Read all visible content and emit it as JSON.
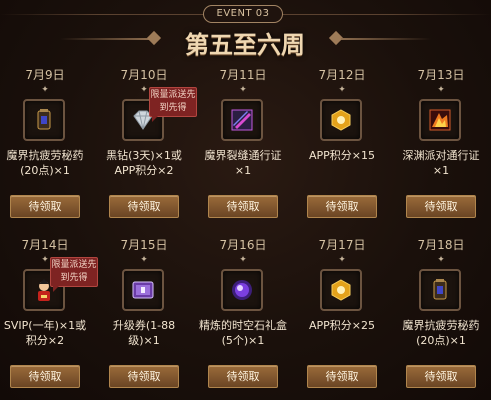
{
  "header": {
    "event_label": "EVENT 03",
    "title": "第五至六周"
  },
  "rewards": [
    {
      "date": "7月9日",
      "desc": "魔界抗疲劳秘药(20点)×1",
      "tag": "",
      "icon": "potion-icon",
      "button": "待领取"
    },
    {
      "date": "7月10日",
      "desc": "黑钻(3天)×1或APP积分×2",
      "tag": "限量派送先到先得",
      "icon": "diamond-icon",
      "button": "待领取"
    },
    {
      "date": "7月11日",
      "desc": "魔界裂缝通行证×1",
      "tag": "",
      "icon": "pass-ticket-icon",
      "button": "待领取"
    },
    {
      "date": "7月12日",
      "desc": "APP积分×15",
      "tag": "",
      "icon": "app-points-icon",
      "button": "待领取"
    },
    {
      "date": "7月13日",
      "desc": "深渊派对通行证×1",
      "tag": "",
      "icon": "abyss-ticket-icon",
      "button": "待领取"
    },
    {
      "date": "7月14日",
      "desc": "SVIP(一年)×1或积分×2",
      "tag": "限量派送先到先得",
      "icon": "svip-character-icon",
      "button": "待领取"
    },
    {
      "date": "7月15日",
      "desc": "升级券(1-88级)×1",
      "tag": "",
      "icon": "level-coupon-icon",
      "button": "待领取"
    },
    {
      "date": "7月16日",
      "desc": "精炼的时空石礼盒(5个)×1",
      "tag": "",
      "icon": "orb-giftbox-icon",
      "button": "待领取"
    },
    {
      "date": "7月17日",
      "desc": "APP积分×25",
      "tag": "",
      "icon": "app-points-icon",
      "button": "待领取"
    },
    {
      "date": "7月18日",
      "desc": "魔界抗疲劳秘药(20点)×1",
      "tag": "",
      "icon": "potion-icon",
      "button": "待领取"
    }
  ],
  "colors": {
    "button_top": "#9a6b3a",
    "button_bottom": "#6b4524",
    "tag_red": "#7e2322",
    "item_border": "#6c5440"
  }
}
